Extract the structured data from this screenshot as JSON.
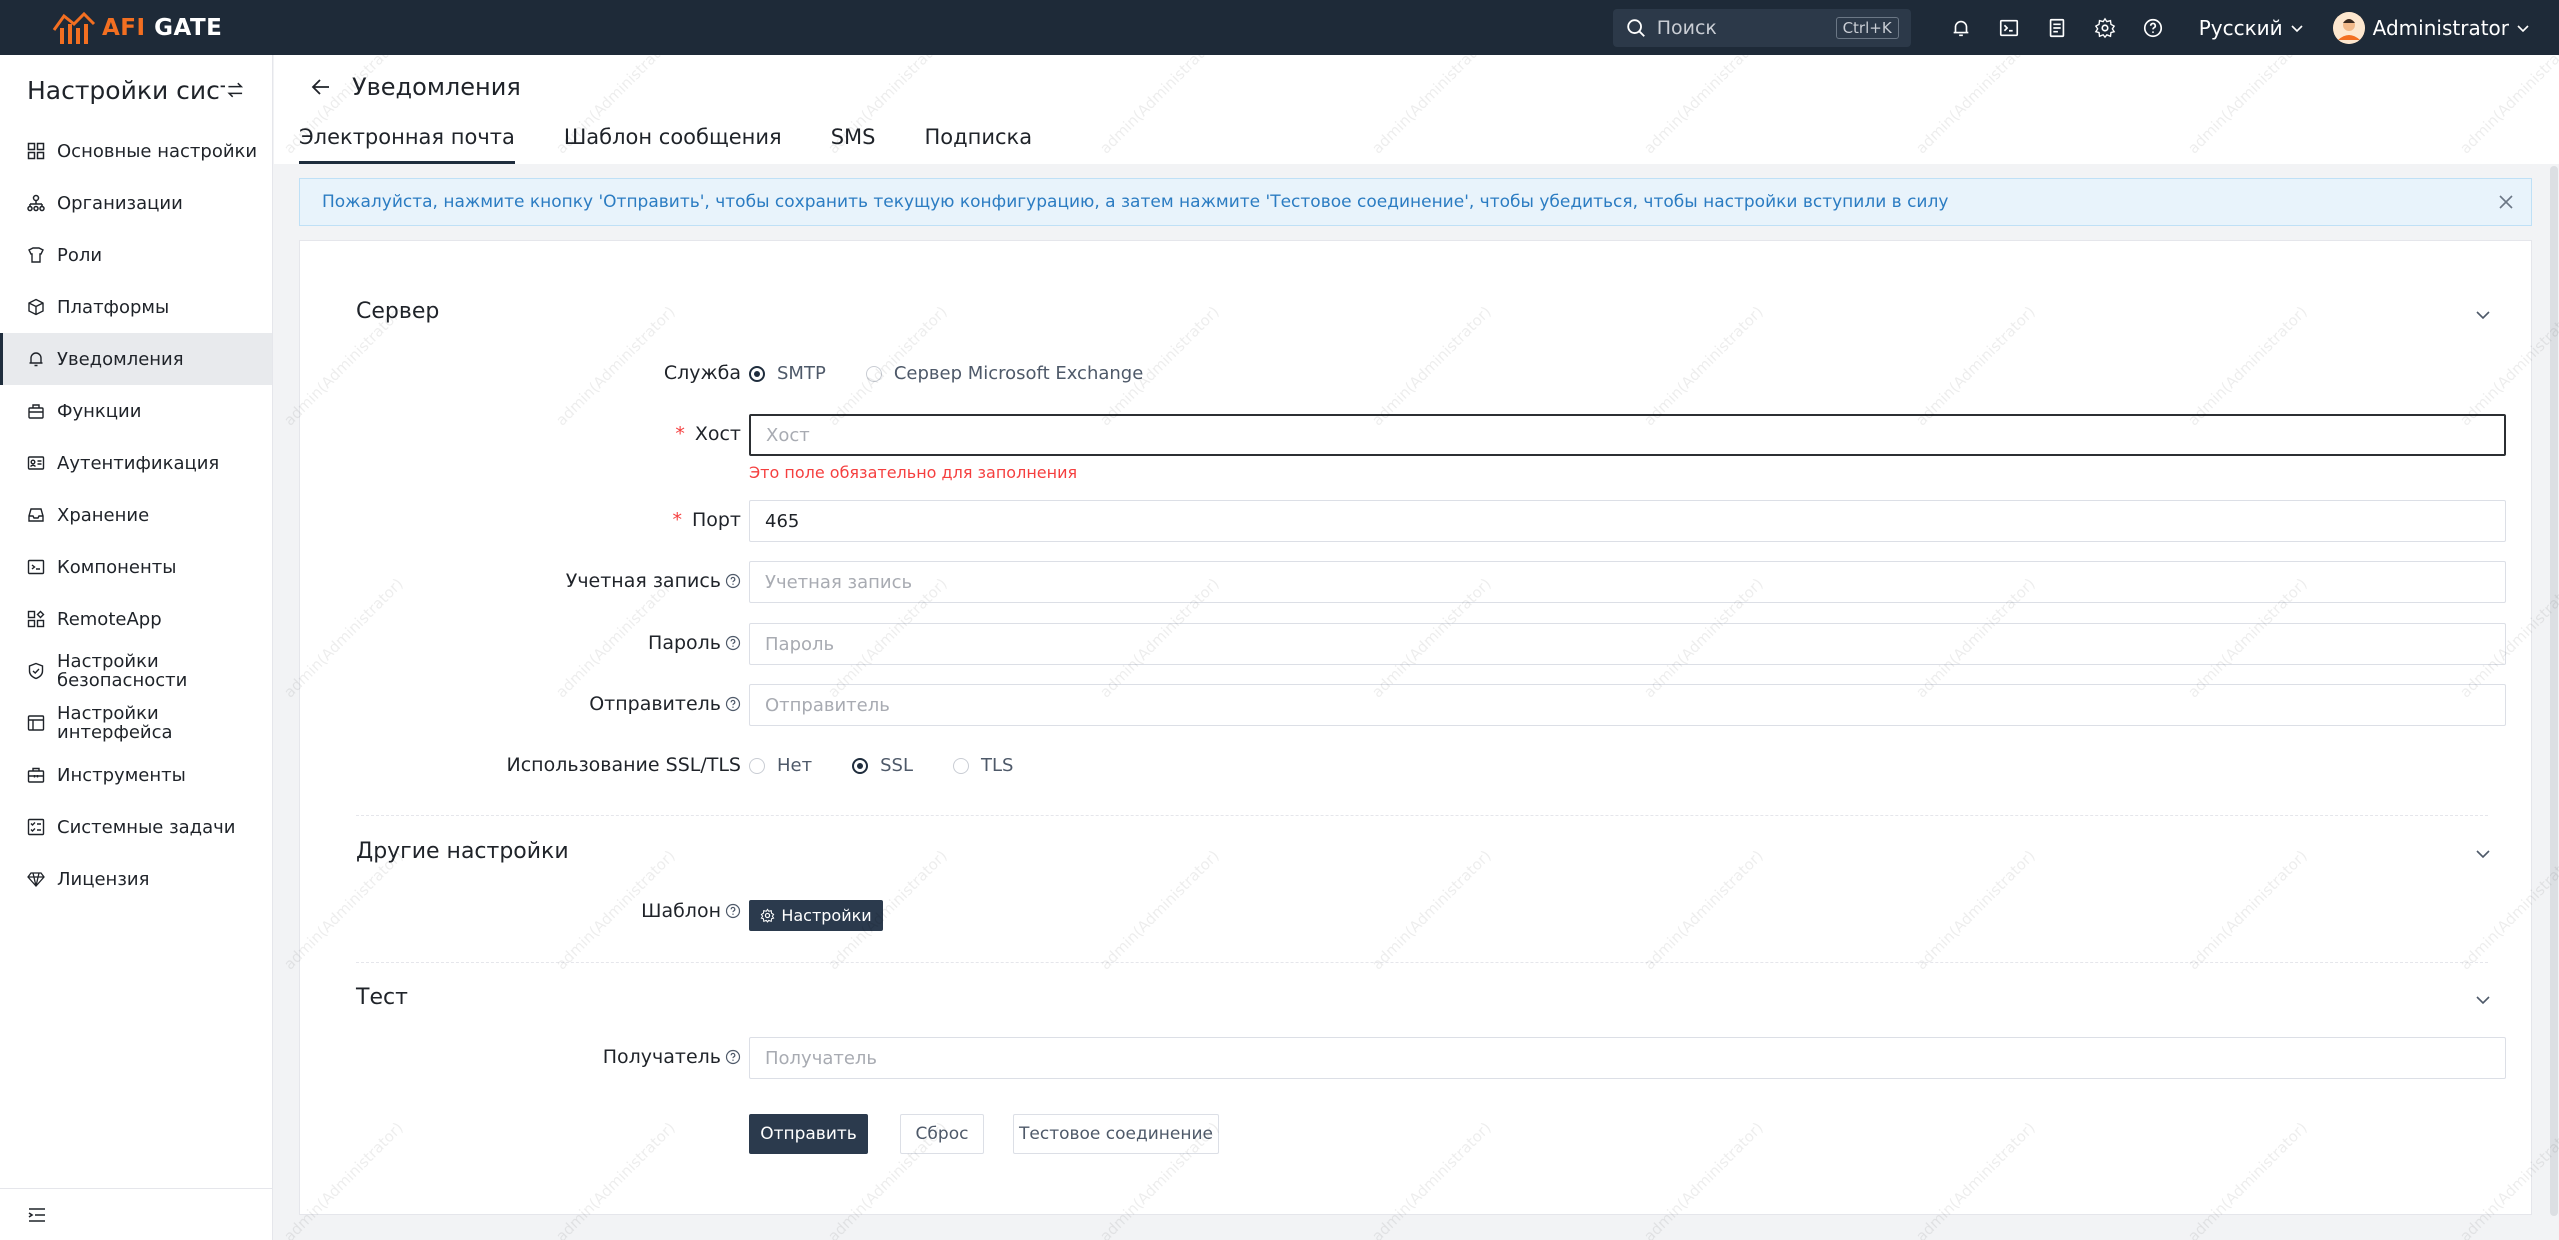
{
  "app": {
    "logo_brand": "AFI",
    "logo_product": "GATE"
  },
  "topbar": {
    "search_placeholder": "Поиск",
    "search_shortcut": "Ctrl+K",
    "language": "Русский",
    "user": "Administrator"
  },
  "sidebar": {
    "title": "Настройки сист...",
    "items": [
      {
        "label": "Основные настройки",
        "icon": "grid-icon"
      },
      {
        "label": "Организации",
        "icon": "org-icon"
      },
      {
        "label": "Роли",
        "icon": "role-icon"
      },
      {
        "label": "Платформы",
        "icon": "cube-icon"
      },
      {
        "label": "Уведомления",
        "icon": "bell-icon",
        "active": true
      },
      {
        "label": "Функции",
        "icon": "function-icon"
      },
      {
        "label": "Аутентификация",
        "icon": "id-card-icon"
      },
      {
        "label": "Хранение",
        "icon": "inbox-icon"
      },
      {
        "label": "Компоненты",
        "icon": "terminal-icon"
      },
      {
        "label": "RemoteApp",
        "icon": "apps-icon"
      },
      {
        "label_line1": "Настройки",
        "label_line2": "безопасности",
        "icon": "shield-icon"
      },
      {
        "label_line1": "Настройки",
        "label_line2": "интерфейса",
        "icon": "interface-icon"
      },
      {
        "label": "Инструменты",
        "icon": "toolbox-icon"
      },
      {
        "label": "Системные задачи",
        "icon": "tasks-icon"
      },
      {
        "label": "Лицензия",
        "icon": "license-icon"
      }
    ]
  },
  "page": {
    "title": "Уведомления",
    "tabs": [
      {
        "label": "Электронная почта",
        "active": true
      },
      {
        "label": "Шаблон сообщения"
      },
      {
        "label": "SMS"
      },
      {
        "label": "Подписка"
      }
    ],
    "alert": "Пожалуйста, нажмите кнопку 'Отправить', чтобы сохранить текущую конфигурацию, а затем нажмите 'Тестовое соединение', чтобы убедиться, чтобы настройки вступили в силу"
  },
  "server": {
    "title": "Сервер",
    "service_label": "Служба",
    "service_options": [
      "SMTP",
      "Сервер Microsoft Exchange"
    ],
    "service_selected": "SMTP",
    "host_label": "Хост",
    "host_placeholder": "Хост",
    "host_value": "",
    "host_error": "Это поле обязательно для заполнения",
    "port_label": "Порт",
    "port_value": "465",
    "account_label": "Учетная запись",
    "account_placeholder": "Учетная запись",
    "password_label": "Пароль",
    "password_placeholder": "Пароль",
    "sender_label": "Отправитель",
    "sender_placeholder": "Отправитель",
    "ssl_label": "Использование SSL/TLS",
    "ssl_options": [
      "Нет",
      "SSL",
      "TLS"
    ],
    "ssl_selected": "SSL"
  },
  "other": {
    "title": "Другие настройки",
    "template_label": "Шаблон",
    "settings_button": "Настройки"
  },
  "test": {
    "title": "Тест",
    "recipient_label": "Получатель",
    "recipient_placeholder": "Получатель"
  },
  "actions": {
    "submit": "Отправить",
    "reset": "Сброс",
    "test_connection": "Тестовое соединение"
  },
  "watermark": "admin(Administrator)",
  "colors": {
    "topbar": "#1e2a38",
    "accent": "#f36f21",
    "primary_dark": "#2b3a4d",
    "error": "#f53f3f",
    "info": "#2b7cc2"
  }
}
